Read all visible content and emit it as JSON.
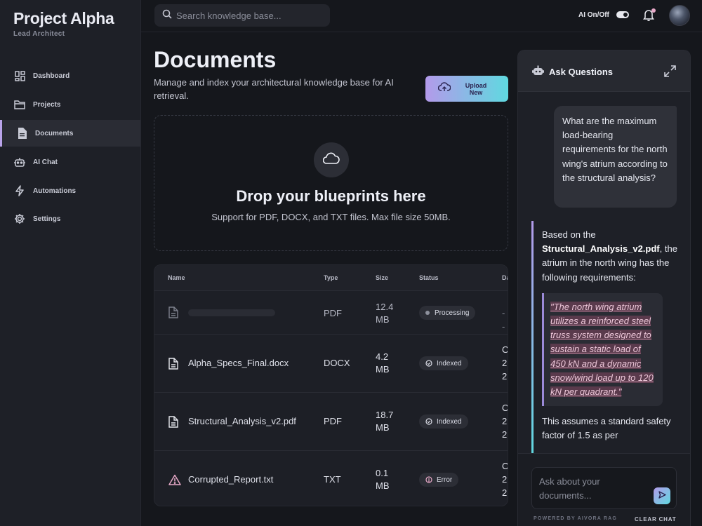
{
  "sidebar": {
    "brand": "Project Alpha",
    "subtitle": "Lead Architect",
    "items": [
      {
        "label": "Dashboard",
        "icon": "dashboard-grid-icon"
      },
      {
        "label": "Projects",
        "icon": "folder-icon"
      },
      {
        "label": "Documents",
        "icon": "document-icon",
        "active": true
      },
      {
        "label": "AI Chat",
        "icon": "robot-icon"
      },
      {
        "label": "Automations",
        "icon": "lightning-icon"
      },
      {
        "label": "Settings",
        "icon": "gear-icon"
      }
    ]
  },
  "topbar": {
    "search_placeholder": "Search knowledge base...",
    "ai_toggle_label": "AI On/Off",
    "ai_toggle_on": true
  },
  "main": {
    "title": "Documents",
    "description": "Manage and index your architectural knowledge base for AI retrieval.",
    "upload_label": "Upload New",
    "dropzone": {
      "title": "Drop your blueprints here",
      "subtitle": "Support for PDF, DOCX, and TXT files. Max file size 50MB."
    },
    "table": {
      "columns": [
        "Name",
        "Type",
        "Size",
        "Status",
        "Da"
      ],
      "rows": [
        {
          "name": "",
          "type": "PDF",
          "size_value": "12.4",
          "size_unit": "MB",
          "status": "Processing",
          "date_fragments": [
            "--"
          ],
          "icon": "document-icon"
        },
        {
          "name": "Alpha_Specs_Final.docx",
          "type": "DOCX",
          "size_value": "4.2",
          "size_unit": "MB",
          "status": "Indexed",
          "date_fragments": [
            "O",
            "2",
            "2"
          ],
          "icon": "document-icon"
        },
        {
          "name": "Structural_Analysis_v2.pdf",
          "type": "PDF",
          "size_value": "18.7",
          "size_unit": "MB",
          "status": "Indexed",
          "date_fragments": [
            "O",
            "2",
            "2"
          ],
          "icon": "document-icon"
        },
        {
          "name": "Corrupted_Report.txt",
          "type": "TXT",
          "size_value": "0.1",
          "size_unit": "MB",
          "status": "Error",
          "date_fragments": [
            "O",
            "2",
            "2"
          ],
          "icon": "warning-triangle-icon"
        }
      ]
    }
  },
  "chat": {
    "title": "Ask Questions",
    "user_message": "What are the maximum load-bearing requirements for the north wing's atrium according to the structural analysis?",
    "ai_intro": "Based on the",
    "ai_source": "Structural_Analysis_v2.pdf",
    "ai_intro_rest": ", the atrium in the north wing has the following requirements:",
    "ai_quote": "\"The north wing atrium utilizes a reinforced steel truss system designed to sustain a static load of 450 kN and a dynamic snow/wind load up to 120 kN per quadrant.\"",
    "ai_followup": "This assumes a standard safety factor of 1.5 as per",
    "input_placeholder": "Ask about your documents...",
    "powered_by": "POWERED BY AIVORA RAG",
    "clear_label": "CLEAR CHAT"
  },
  "colors": {
    "accent_purple": "#b39aea",
    "accent_cyan": "#5fd9e0",
    "background": "#15171c",
    "sidebar": "#1e2027"
  }
}
